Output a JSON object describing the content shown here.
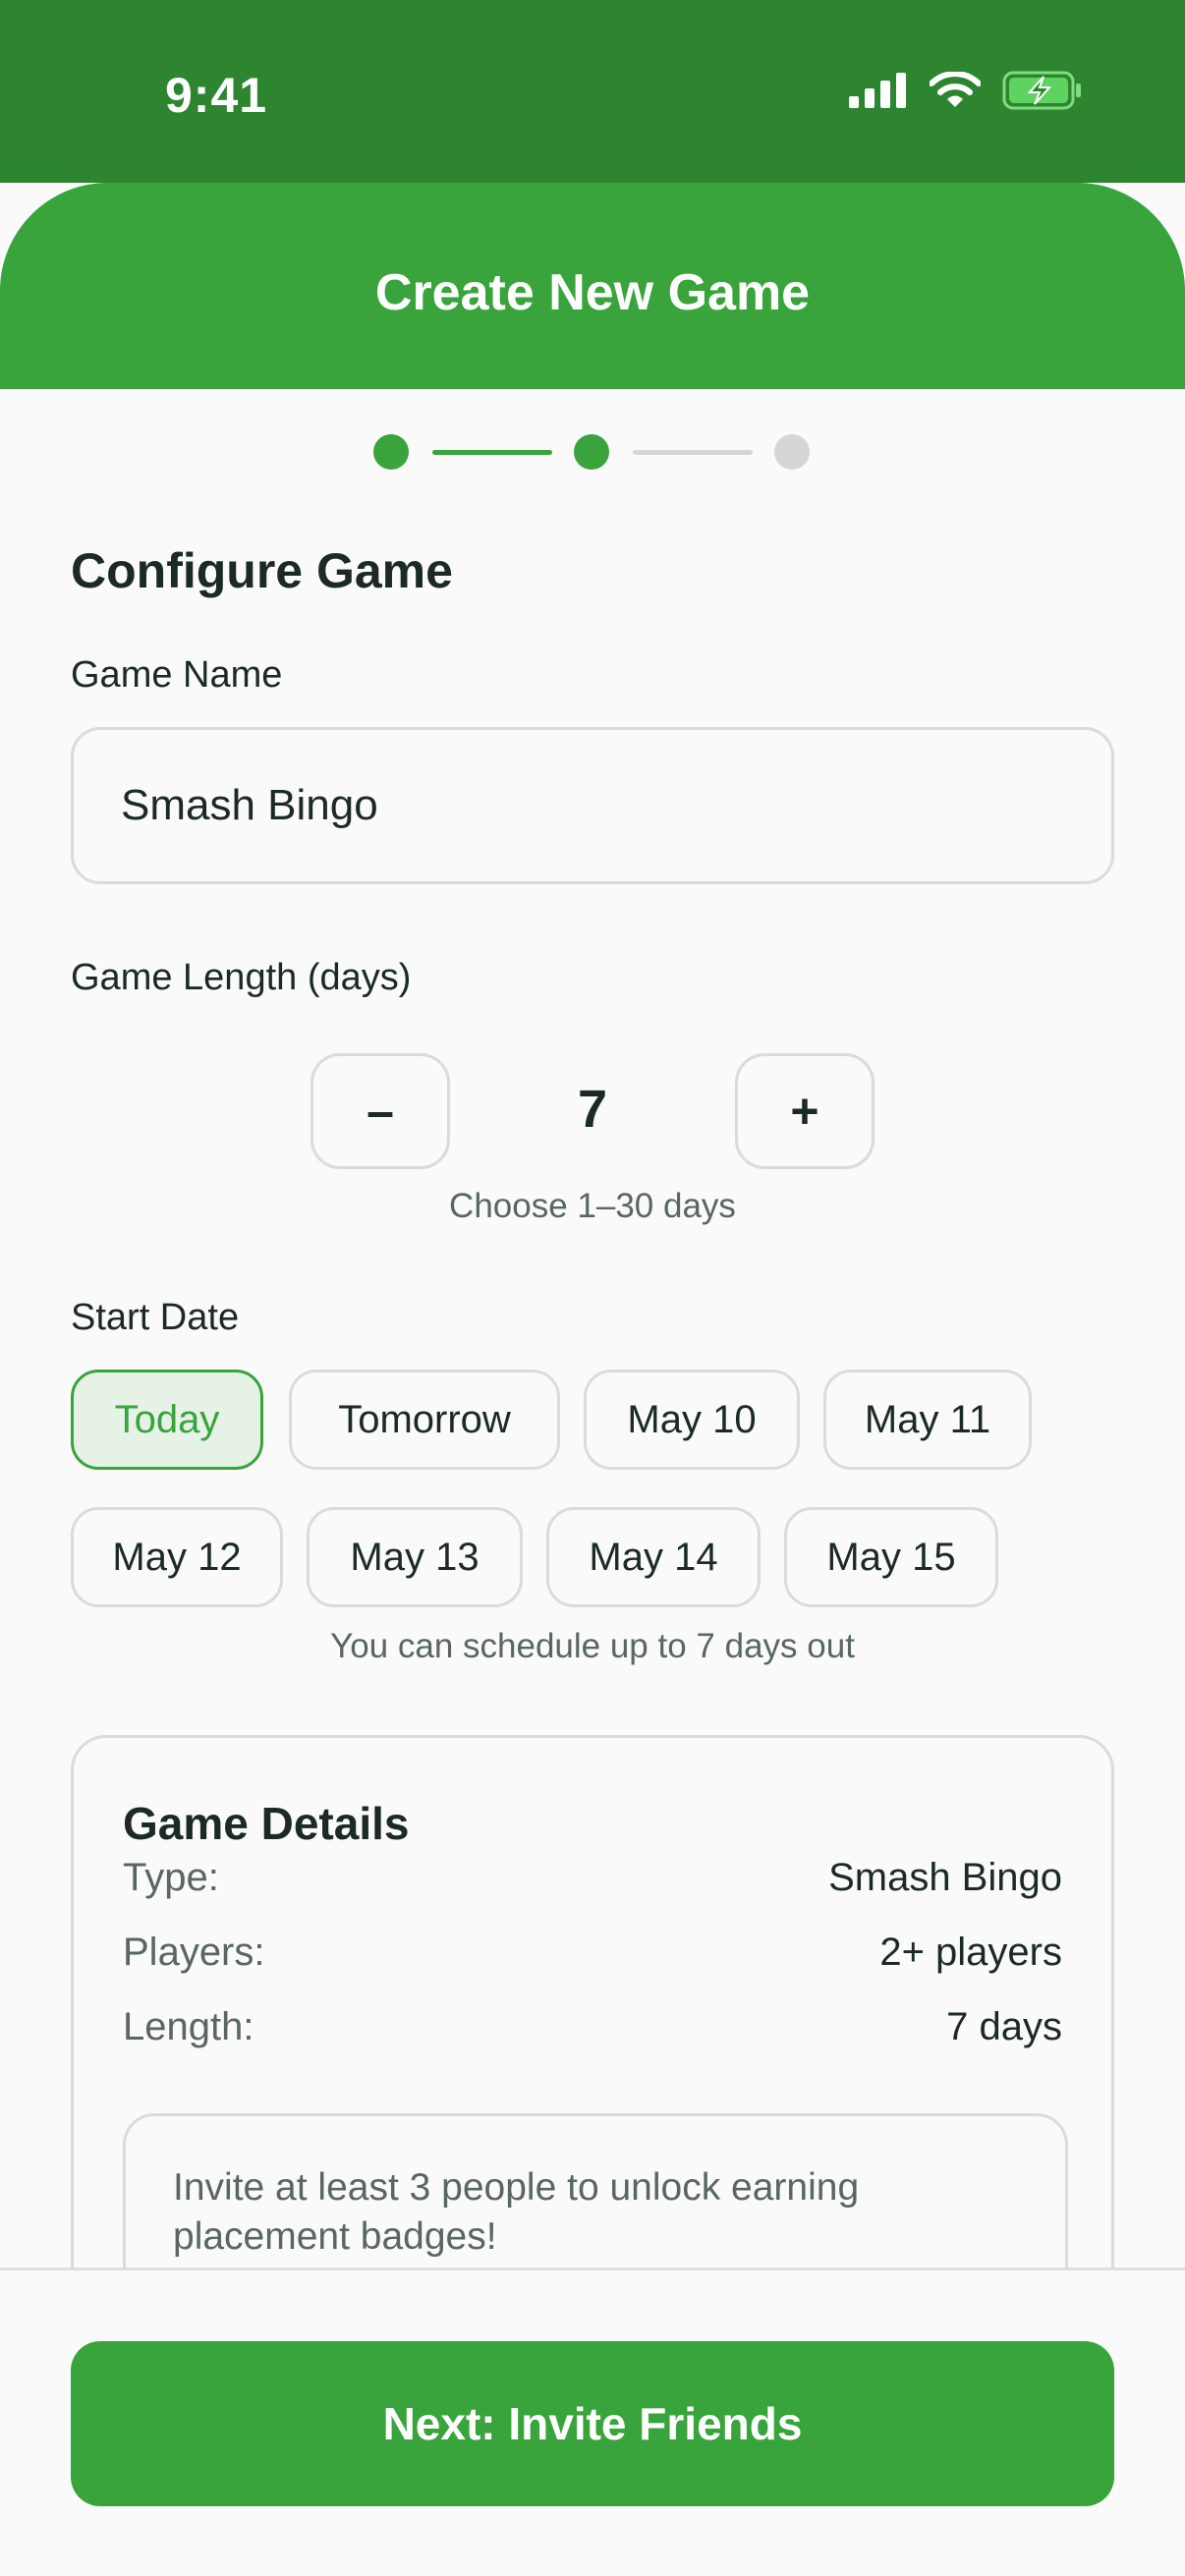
{
  "status_bar": {
    "time": "9:41"
  },
  "header": {
    "title": "Create New Game"
  },
  "progress": {
    "current_step": 2,
    "total_steps": 3
  },
  "form": {
    "section_title": "Configure Game",
    "game_name": {
      "label": "Game Name",
      "value": "Smash Bingo"
    },
    "game_length": {
      "label": "Game Length (days)",
      "decrement_label": "–",
      "increment_label": "+",
      "value": "7",
      "hint": "Choose 1–30 days"
    },
    "start_date": {
      "label": "Start Date",
      "options": [
        "Today",
        "Tomorrow",
        "May 10",
        "May 11",
        "May 12",
        "May 13",
        "May 14",
        "May 15"
      ],
      "selected": "Today",
      "hint": "You can schedule up to 7 days out"
    }
  },
  "details": {
    "title": "Game Details",
    "rows": [
      {
        "key": "Type:",
        "value": "Smash Bingo"
      },
      {
        "key": "Players:",
        "value": "2+ players"
      },
      {
        "key": "Length:",
        "value": "7 days"
      }
    ],
    "note": "Invite at least 3 people to unlock earning placement badges!"
  },
  "footer": {
    "next_label": "Next: Invite Friends"
  },
  "colors": {
    "primary": "#38a43b",
    "status_bar": "#2e8530",
    "inactive": "#d6d6d6"
  }
}
